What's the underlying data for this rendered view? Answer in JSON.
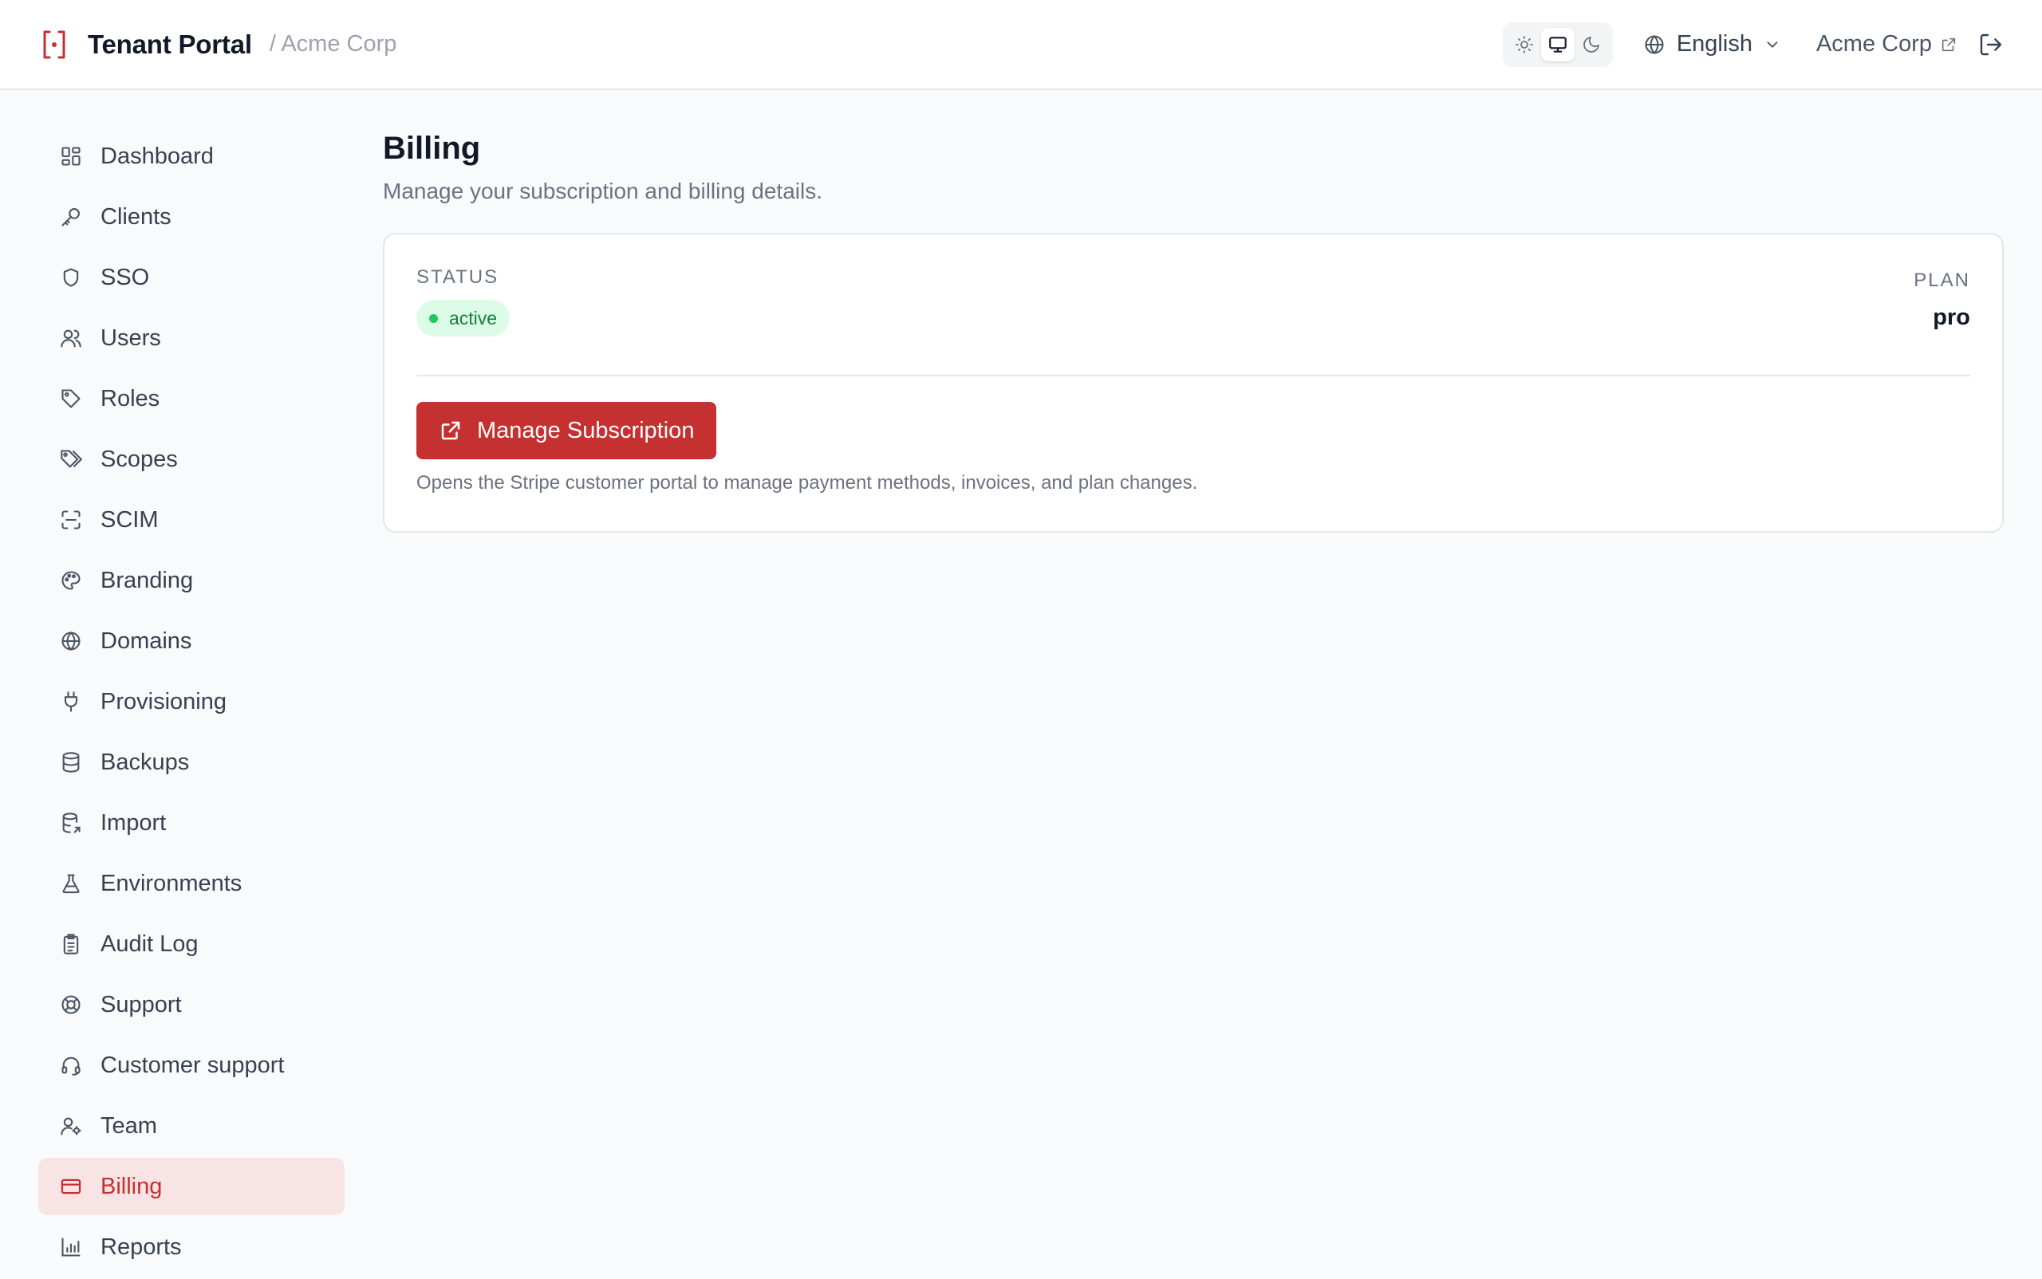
{
  "header": {
    "title": "Tenant Portal",
    "breadcrumb": "/ Acme Corp",
    "theme_options": [
      "light",
      "system",
      "dark"
    ],
    "theme_selected": "system",
    "language": "English",
    "tenant_link": "Acme Corp",
    "logout_icon": "logout-icon"
  },
  "sidebar": {
    "items": [
      {
        "label": "Dashboard",
        "icon": "dashboard-icon"
      },
      {
        "label": "Clients",
        "icon": "key-icon"
      },
      {
        "label": "SSO",
        "icon": "shield-icon"
      },
      {
        "label": "Users",
        "icon": "users-icon"
      },
      {
        "label": "Roles",
        "icon": "tag-icon"
      },
      {
        "label": "Scopes",
        "icon": "tags-icon"
      },
      {
        "label": "SCIM",
        "icon": "scan-icon"
      },
      {
        "label": "Branding",
        "icon": "palette-icon"
      },
      {
        "label": "Domains",
        "icon": "globe-icon"
      },
      {
        "label": "Provisioning",
        "icon": "plug-icon"
      },
      {
        "label": "Backups",
        "icon": "database-icon"
      },
      {
        "label": "Import",
        "icon": "database-import-icon"
      },
      {
        "label": "Environments",
        "icon": "flask-icon"
      },
      {
        "label": "Audit Log",
        "icon": "clipboard-icon"
      },
      {
        "label": "Support",
        "icon": "lifebuoy-icon"
      },
      {
        "label": "Customer support",
        "icon": "headset-icon"
      },
      {
        "label": "Team",
        "icon": "user-gear-icon"
      },
      {
        "label": "Billing",
        "icon": "credit-card-icon"
      },
      {
        "label": "Reports",
        "icon": "bar-chart-icon"
      }
    ],
    "active": "Billing"
  },
  "main": {
    "title": "Billing",
    "subtitle": "Manage your subscription and billing details.",
    "status_label": "STATUS",
    "status_value": "active",
    "plan_label": "PLAN",
    "plan_value": "pro",
    "manage_button": "Manage Subscription",
    "help_text": "Opens the Stripe customer portal to manage payment methods, invoices, and plan changes."
  },
  "colors": {
    "accent": "#c53030",
    "active_nav_bg": "#f8e4e4",
    "status_bg": "#dcfce7",
    "status_text": "#15803d"
  }
}
